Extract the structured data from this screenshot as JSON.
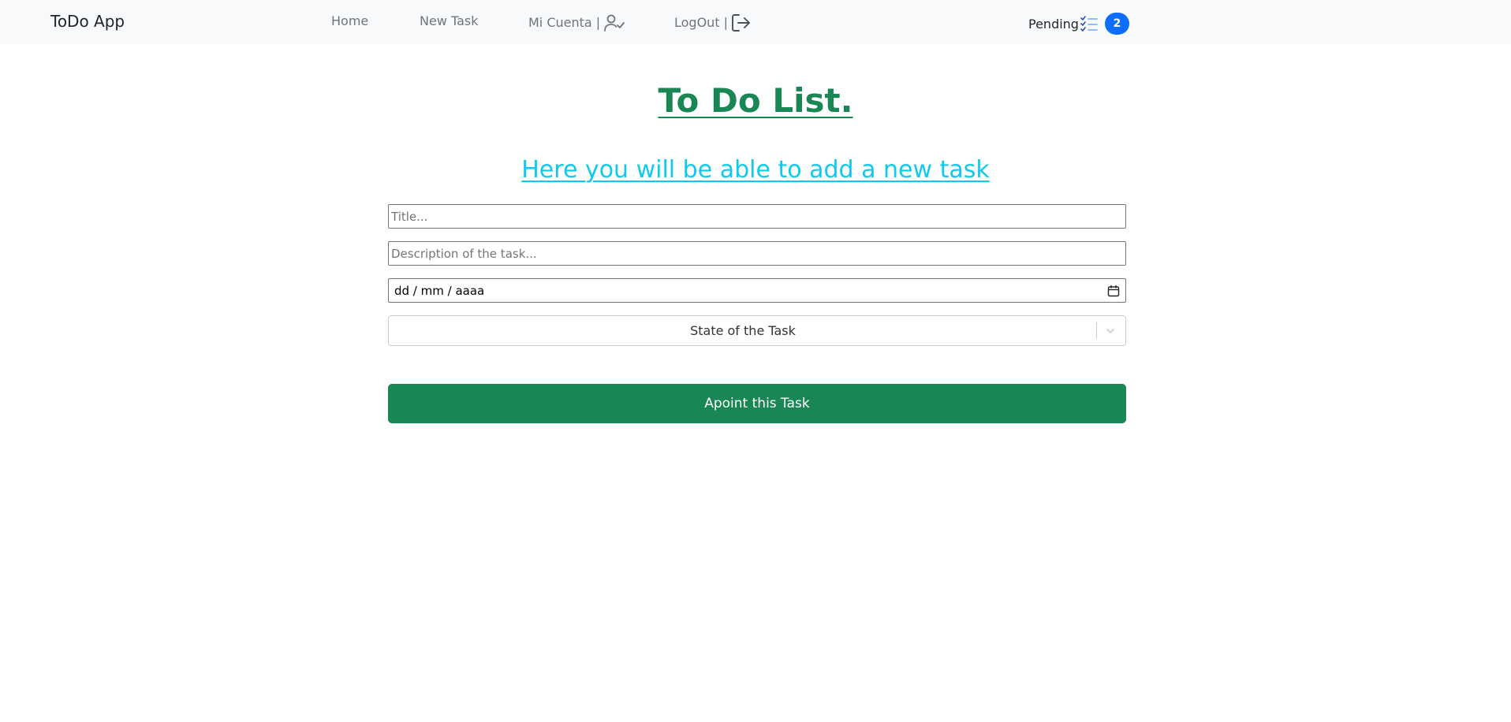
{
  "navbar": {
    "brand": "ToDo App",
    "links": {
      "home": "Home",
      "new_task": "New Task",
      "account": "Mi Cuenta |",
      "logout": "LogOut |"
    },
    "pending": {
      "label": "Pending",
      "count": "2",
      "icon": "list-check-icon"
    },
    "icons": {
      "account": "user-check-icon",
      "logout": "logout-icon"
    }
  },
  "main": {
    "title": "To Do List.",
    "subtitle": "Here you will be able to add a new task"
  },
  "form": {
    "title_placeholder": "Title...",
    "description_placeholder": "Description of the task...",
    "date_value": "dd / mm / aaaa",
    "state_select": "State of the Task",
    "submit_label": "Apoint this Task"
  },
  "colors": {
    "accent_green": "#198754",
    "link_cyan": "#0dcaf0",
    "badge_blue": "#0d6efd",
    "navbar_bg": "#f8f9fa"
  }
}
